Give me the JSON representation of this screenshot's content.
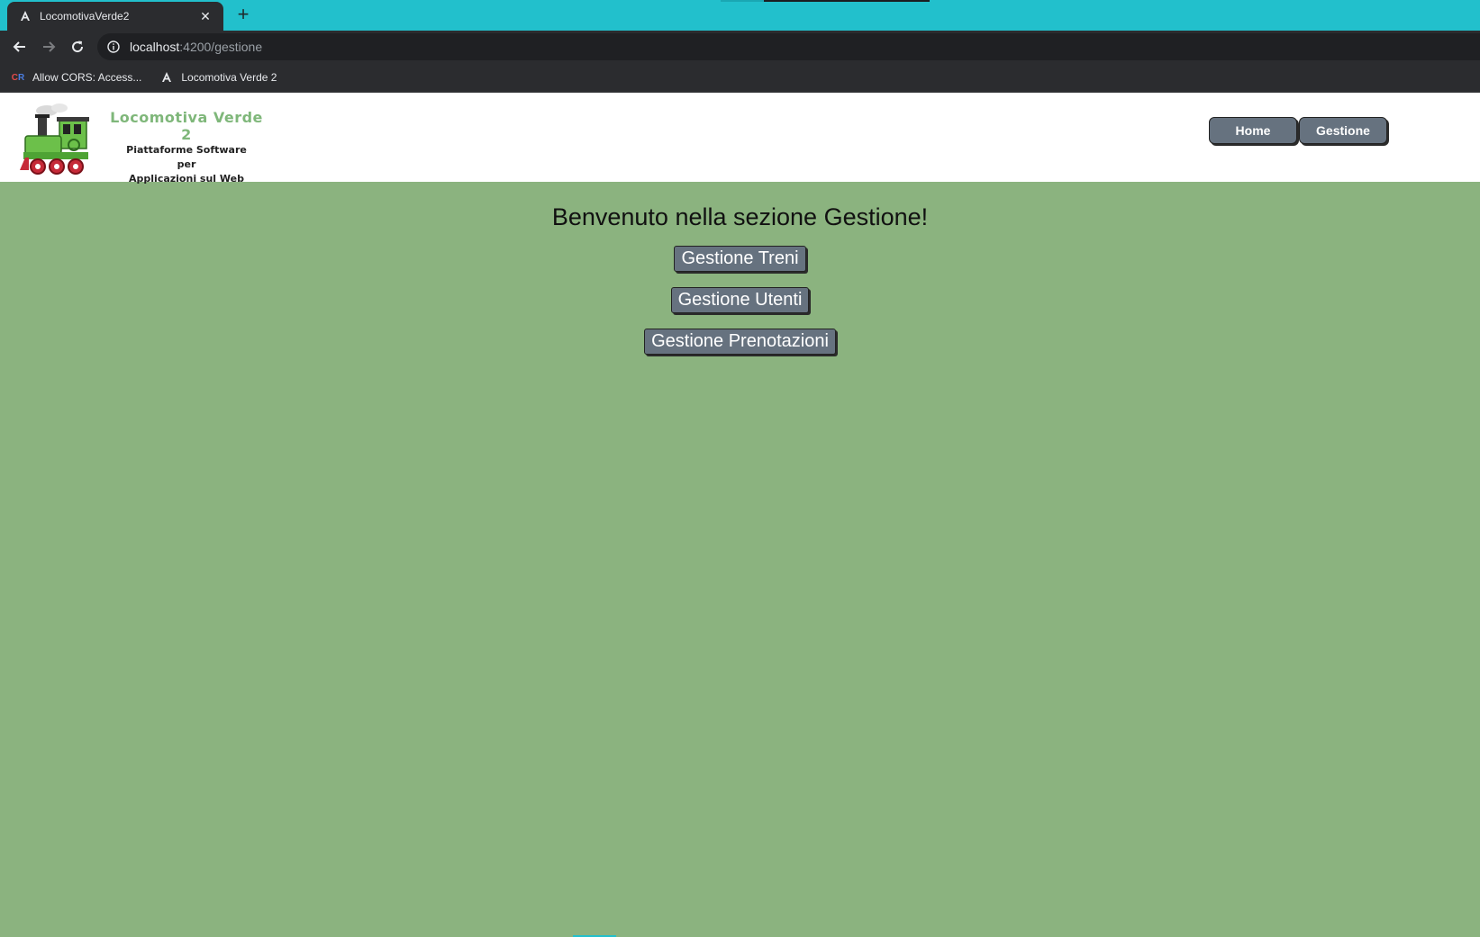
{
  "browser": {
    "tab_title": "LocomotivaVerde2",
    "tab_close": "✕",
    "new_tab": "+",
    "url_host": "localhost",
    "url_path": ":4200/gestione",
    "bookmarks": [
      {
        "label": "Allow CORS: Access...",
        "icon": "cors-extension-icon"
      },
      {
        "label": "Locomotiva Verde 2",
        "icon": "angular-icon"
      }
    ],
    "colors": {
      "tabstrip": "#22c0cc",
      "toolbar": "#2b2c2f"
    }
  },
  "header": {
    "logo": {
      "title": "Locomotiva Verde 2",
      "line1": "Piattaforme Software",
      "line2": "per",
      "line3": "Applicazioni sul Web"
    },
    "nav": {
      "home_label": "Home",
      "gestione_label": "Gestione"
    }
  },
  "main": {
    "title": "Benvenuto nella sezione Gestione!",
    "buttons": {
      "treni": "Gestione Treni",
      "utenti": "Gestione Utenti",
      "prenotazioni": "Gestione Prenotazioni"
    }
  },
  "colors": {
    "page_background": "#8bb37f",
    "button_background": "#66727f",
    "logo_title": "#7fb77a"
  }
}
